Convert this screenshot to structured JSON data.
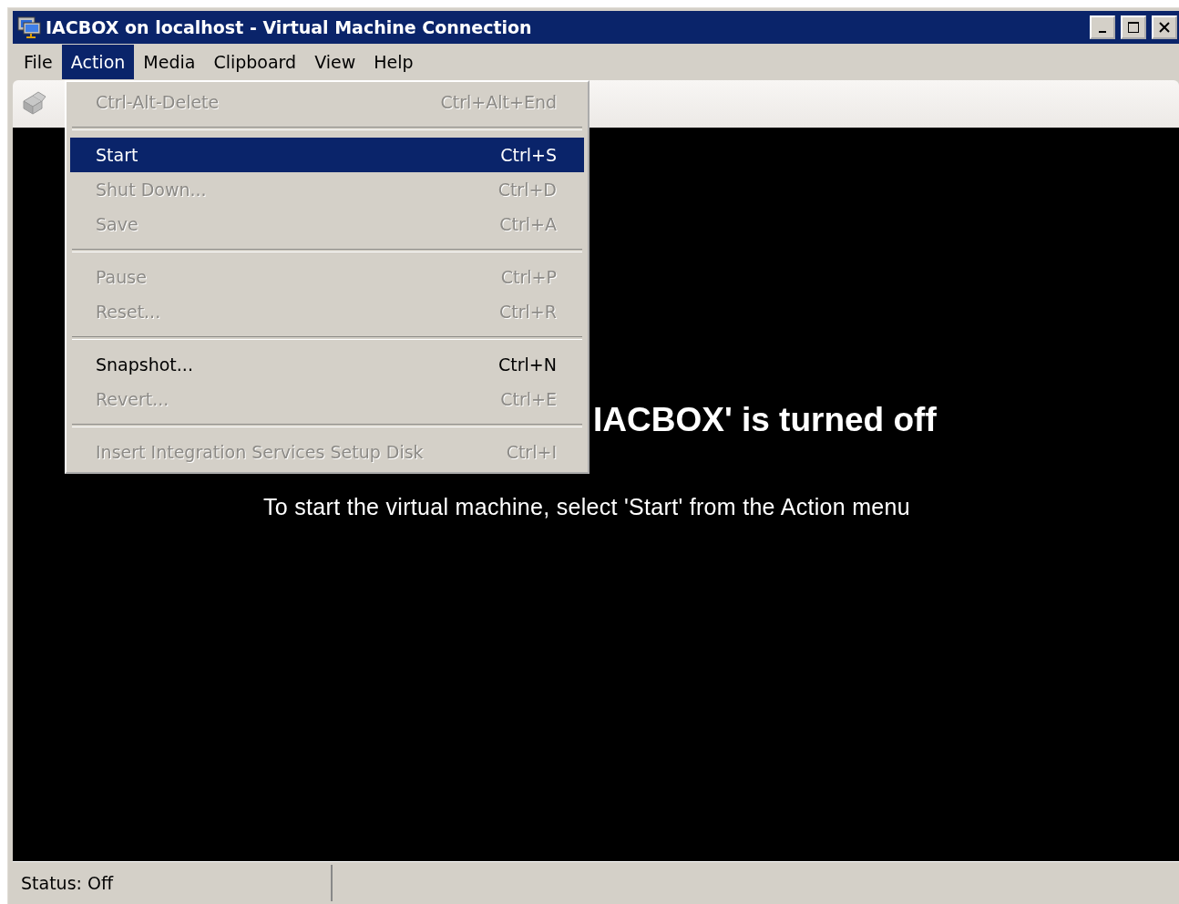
{
  "window": {
    "title": "IACBOX on localhost - Virtual Machine Connection"
  },
  "menu_bar": [
    {
      "label": "File",
      "selected": false
    },
    {
      "label": "Action",
      "selected": true
    },
    {
      "label": "Media",
      "selected": false
    },
    {
      "label": "Clipboard",
      "selected": false
    },
    {
      "label": "View",
      "selected": false
    },
    {
      "label": "Help",
      "selected": false
    }
  ],
  "action_menu": [
    {
      "kind": "item",
      "label": "Ctrl-Alt-Delete",
      "shortcut": "Ctrl+Alt+End",
      "disabled": true,
      "selected": false
    },
    {
      "kind": "separator"
    },
    {
      "kind": "item",
      "label": "Start",
      "shortcut": "Ctrl+S",
      "disabled": false,
      "selected": true
    },
    {
      "kind": "item",
      "label": "Shut Down...",
      "shortcut": "Ctrl+D",
      "disabled": true,
      "selected": false
    },
    {
      "kind": "item",
      "label": "Save",
      "shortcut": "Ctrl+A",
      "disabled": true,
      "selected": false
    },
    {
      "kind": "separator"
    },
    {
      "kind": "item",
      "label": "Pause",
      "shortcut": "Ctrl+P",
      "disabled": true,
      "selected": false
    },
    {
      "kind": "item",
      "label": "Reset...",
      "shortcut": "Ctrl+R",
      "disabled": true,
      "selected": false
    },
    {
      "kind": "separator"
    },
    {
      "kind": "item",
      "label": "Snapshot...",
      "shortcut": "Ctrl+N",
      "disabled": false,
      "selected": false
    },
    {
      "kind": "item",
      "label": "Revert...",
      "shortcut": "Ctrl+E",
      "disabled": true,
      "selected": false
    },
    {
      "kind": "separator"
    },
    {
      "kind": "item",
      "label": "Insert Integration Services Setup Disk",
      "shortcut": "Ctrl+I",
      "disabled": true,
      "selected": false
    }
  ],
  "screen": {
    "heading": "IACBOX' is turned off",
    "message": "To start the virtual machine, select 'Start' from the Action menu"
  },
  "status_bar": {
    "status": "Status: Off"
  }
}
